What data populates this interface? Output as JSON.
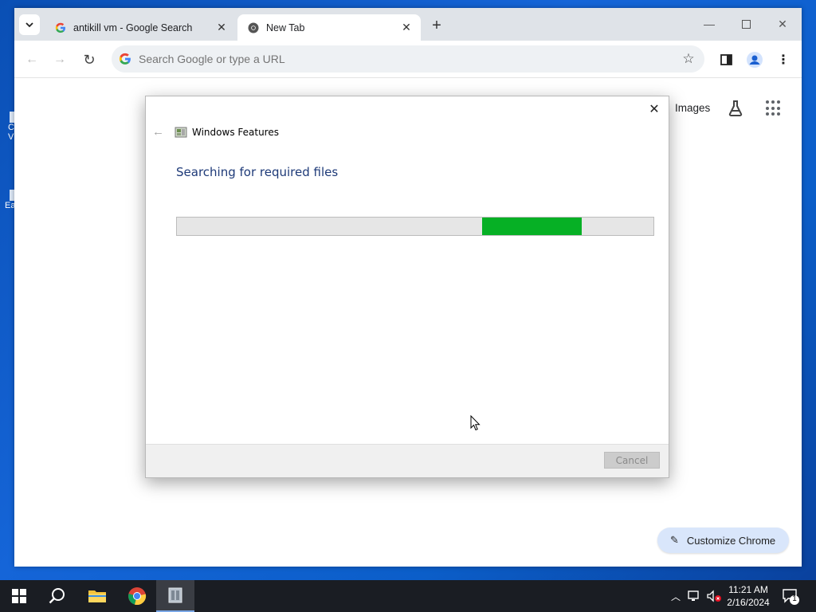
{
  "desktop": {
    "left_edge_labels": [
      "C",
      "V",
      "Ea"
    ]
  },
  "browser": {
    "tabs": [
      {
        "label": "antikill vm - Google Search",
        "favicon": "google-g-icon",
        "active": false
      },
      {
        "label": "New Tab",
        "favicon": "chrome-icon",
        "active": true
      }
    ],
    "omnibox": {
      "placeholder": "Search Google or type a URL"
    },
    "ntp": {
      "images_link": "Images",
      "customize_label": "Customize Chrome"
    }
  },
  "dialog": {
    "title": "Windows Features",
    "heading": "Searching for required files",
    "progress": {
      "chunk_start": 0.64,
      "chunk_end": 0.85,
      "color": "#06b025"
    },
    "cancel_label": "Cancel"
  },
  "taskbar": {
    "time": "11:21 AM",
    "date": "2/16/2024",
    "notification_count": "1"
  },
  "colors": {
    "accent": "#1a73e8",
    "progress_green": "#06b025",
    "taskbar": "#1a1d23"
  }
}
